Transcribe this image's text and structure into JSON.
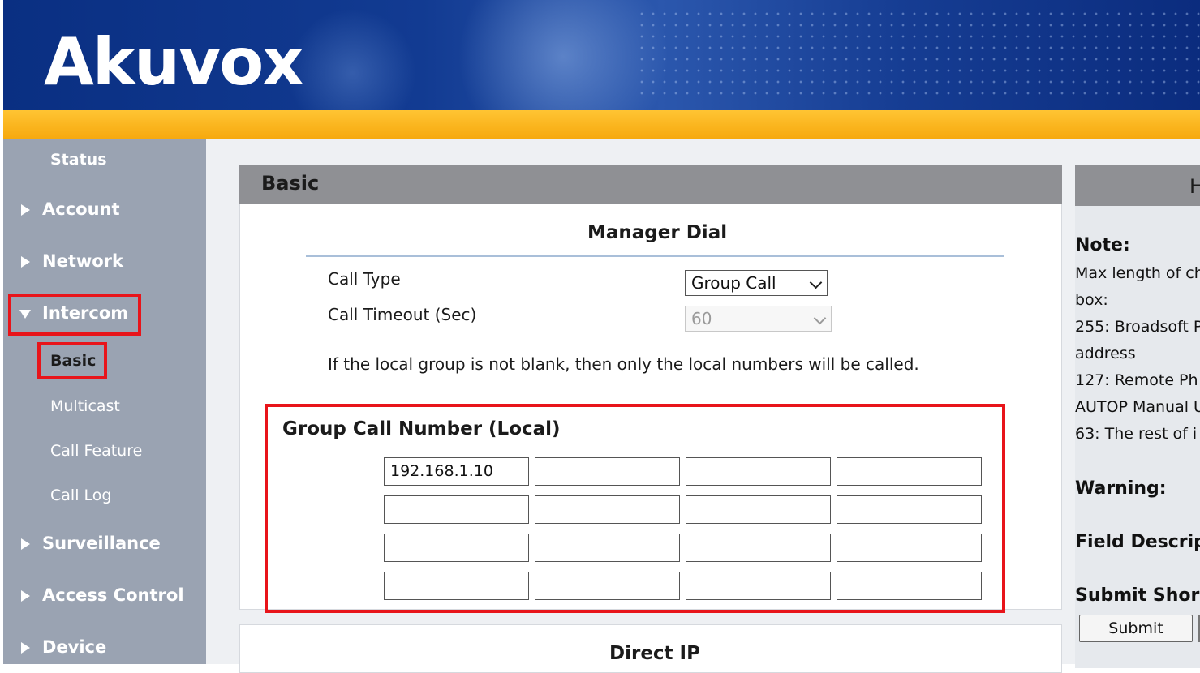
{
  "header": {
    "logo_text": "Akuvox"
  },
  "sidebar": {
    "status": "Status",
    "items": [
      {
        "label": "Account"
      },
      {
        "label": "Network"
      },
      {
        "label": "Intercom"
      },
      {
        "label": "Surveillance"
      },
      {
        "label": "Access Control"
      },
      {
        "label": "Device"
      }
    ],
    "intercom_sub": [
      "Basic",
      "Multicast",
      "Call Feature",
      "Call Log"
    ]
  },
  "panel": {
    "title": "Basic",
    "manager_dial": {
      "title": "Manager Dial",
      "call_type_label": "Call Type",
      "call_type_value": "Group Call",
      "call_timeout_label": "Call Timeout (Sec)",
      "call_timeout_value": "60",
      "note": "If the local group is not blank, then only the local numbers will be called."
    },
    "group_call": {
      "title": "Group Call Number (Local)",
      "cells": [
        [
          "192.168.1.10",
          "",
          "",
          ""
        ],
        [
          "",
          "",
          "",
          ""
        ],
        [
          "",
          "",
          "",
          ""
        ],
        [
          "",
          "",
          "",
          ""
        ]
      ]
    },
    "direct_ip_title": "Direct IP"
  },
  "help": {
    "head": "H",
    "note_title": "Note:",
    "lines": [
      "Max length of ch",
      "box:",
      "255: Broadsoft P",
      "address",
      "127: Remote Ph",
      "AUTOP Manual U",
      "63: The rest of i"
    ],
    "warning": "Warning:",
    "field_desc": "Field Descrip",
    "submit_short": "Submit Shor",
    "submit_button": "Submit"
  },
  "colors": {
    "header_blue": "#0a2f82",
    "stripe_orange": "#f6a80d",
    "sidebar": "#9aa3b2",
    "highlight_red": "#e8141a"
  }
}
